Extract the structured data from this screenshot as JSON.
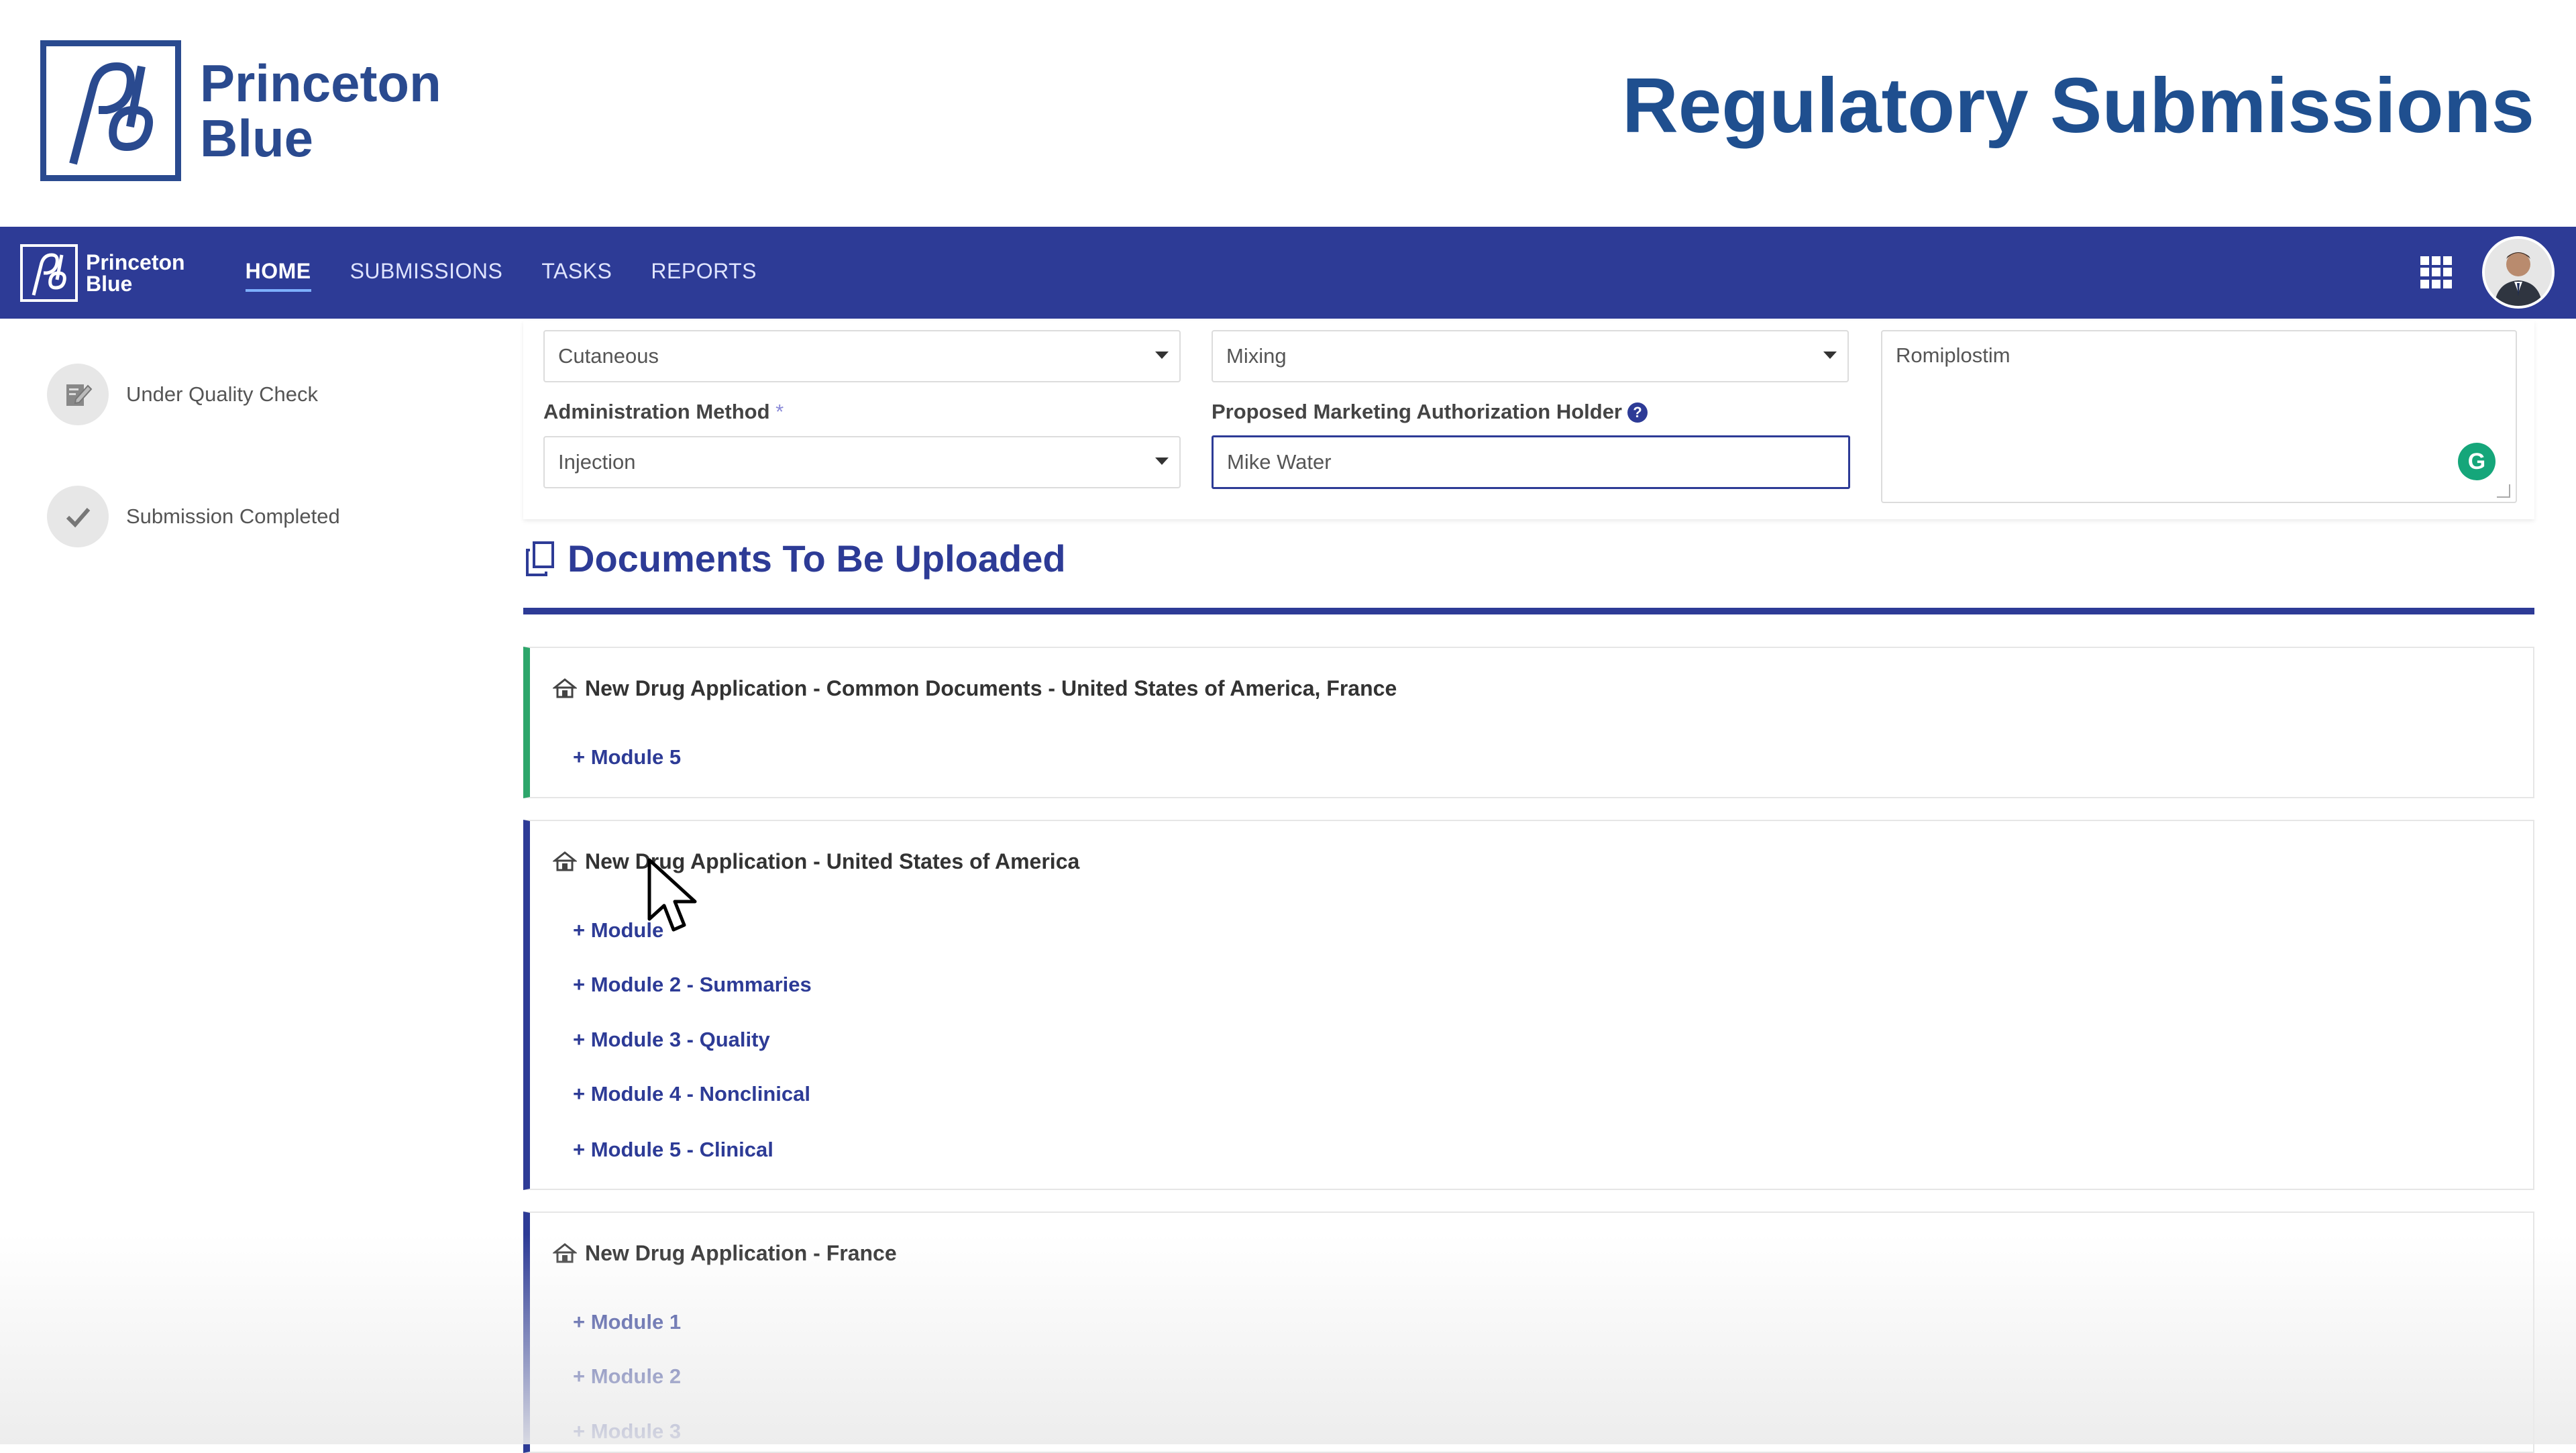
{
  "banner": {
    "brand_line1": "Princeton",
    "brand_line2": "Blue",
    "heading": "Regulatory Submissions"
  },
  "navbar": {
    "brand_line1": "Princeton",
    "brand_line2": "Blue",
    "items": [
      {
        "label": "HOME",
        "active": true
      },
      {
        "label": "SUBMISSIONS",
        "active": false
      },
      {
        "label": "TASKS",
        "active": false
      },
      {
        "label": "REPORTS",
        "active": false
      }
    ],
    "apps_icon": "grid-icon",
    "avatar_icon": "user-avatar"
  },
  "steps": [
    {
      "label": "Under Quality Check",
      "icon": "edit-document-icon"
    },
    {
      "label": "Submission Completed",
      "icon": "checkmark-icon"
    }
  ],
  "form": {
    "route_value": "Cutaneous",
    "dosage_value": "Mixing",
    "description_value": "Romiplostim",
    "admin_method_label": "Administration Method",
    "required_mark": "*",
    "admin_method_value": "Injection",
    "holder_label": "Proposed Marketing Authorization Holder",
    "holder_value": "Mike Water",
    "help_glyph": "?",
    "grammarly_glyph": "G"
  },
  "documents": {
    "title": "Documents To Be Uploaded",
    "groups": [
      {
        "title": "New Drug Application - Common Documents - United States of America, France",
        "modules": [
          "+ Module 5"
        ]
      },
      {
        "title": "New Drug Application - United States of America",
        "modules": [
          "+ Module",
          "+ Module 2 - Summaries",
          "+ Module 3 - Quality",
          "+ Module 4 - Nonclinical",
          "+ Module 5 - Clinical"
        ]
      },
      {
        "title": "New Drug Application - France",
        "modules": [
          "+ Module 1",
          "+ Module 2",
          "+ Module 3"
        ]
      }
    ]
  },
  "colors": {
    "brand_blue": "#2d3b96",
    "heading_blue": "#1f4f8f",
    "accent_green": "#2da66b"
  }
}
